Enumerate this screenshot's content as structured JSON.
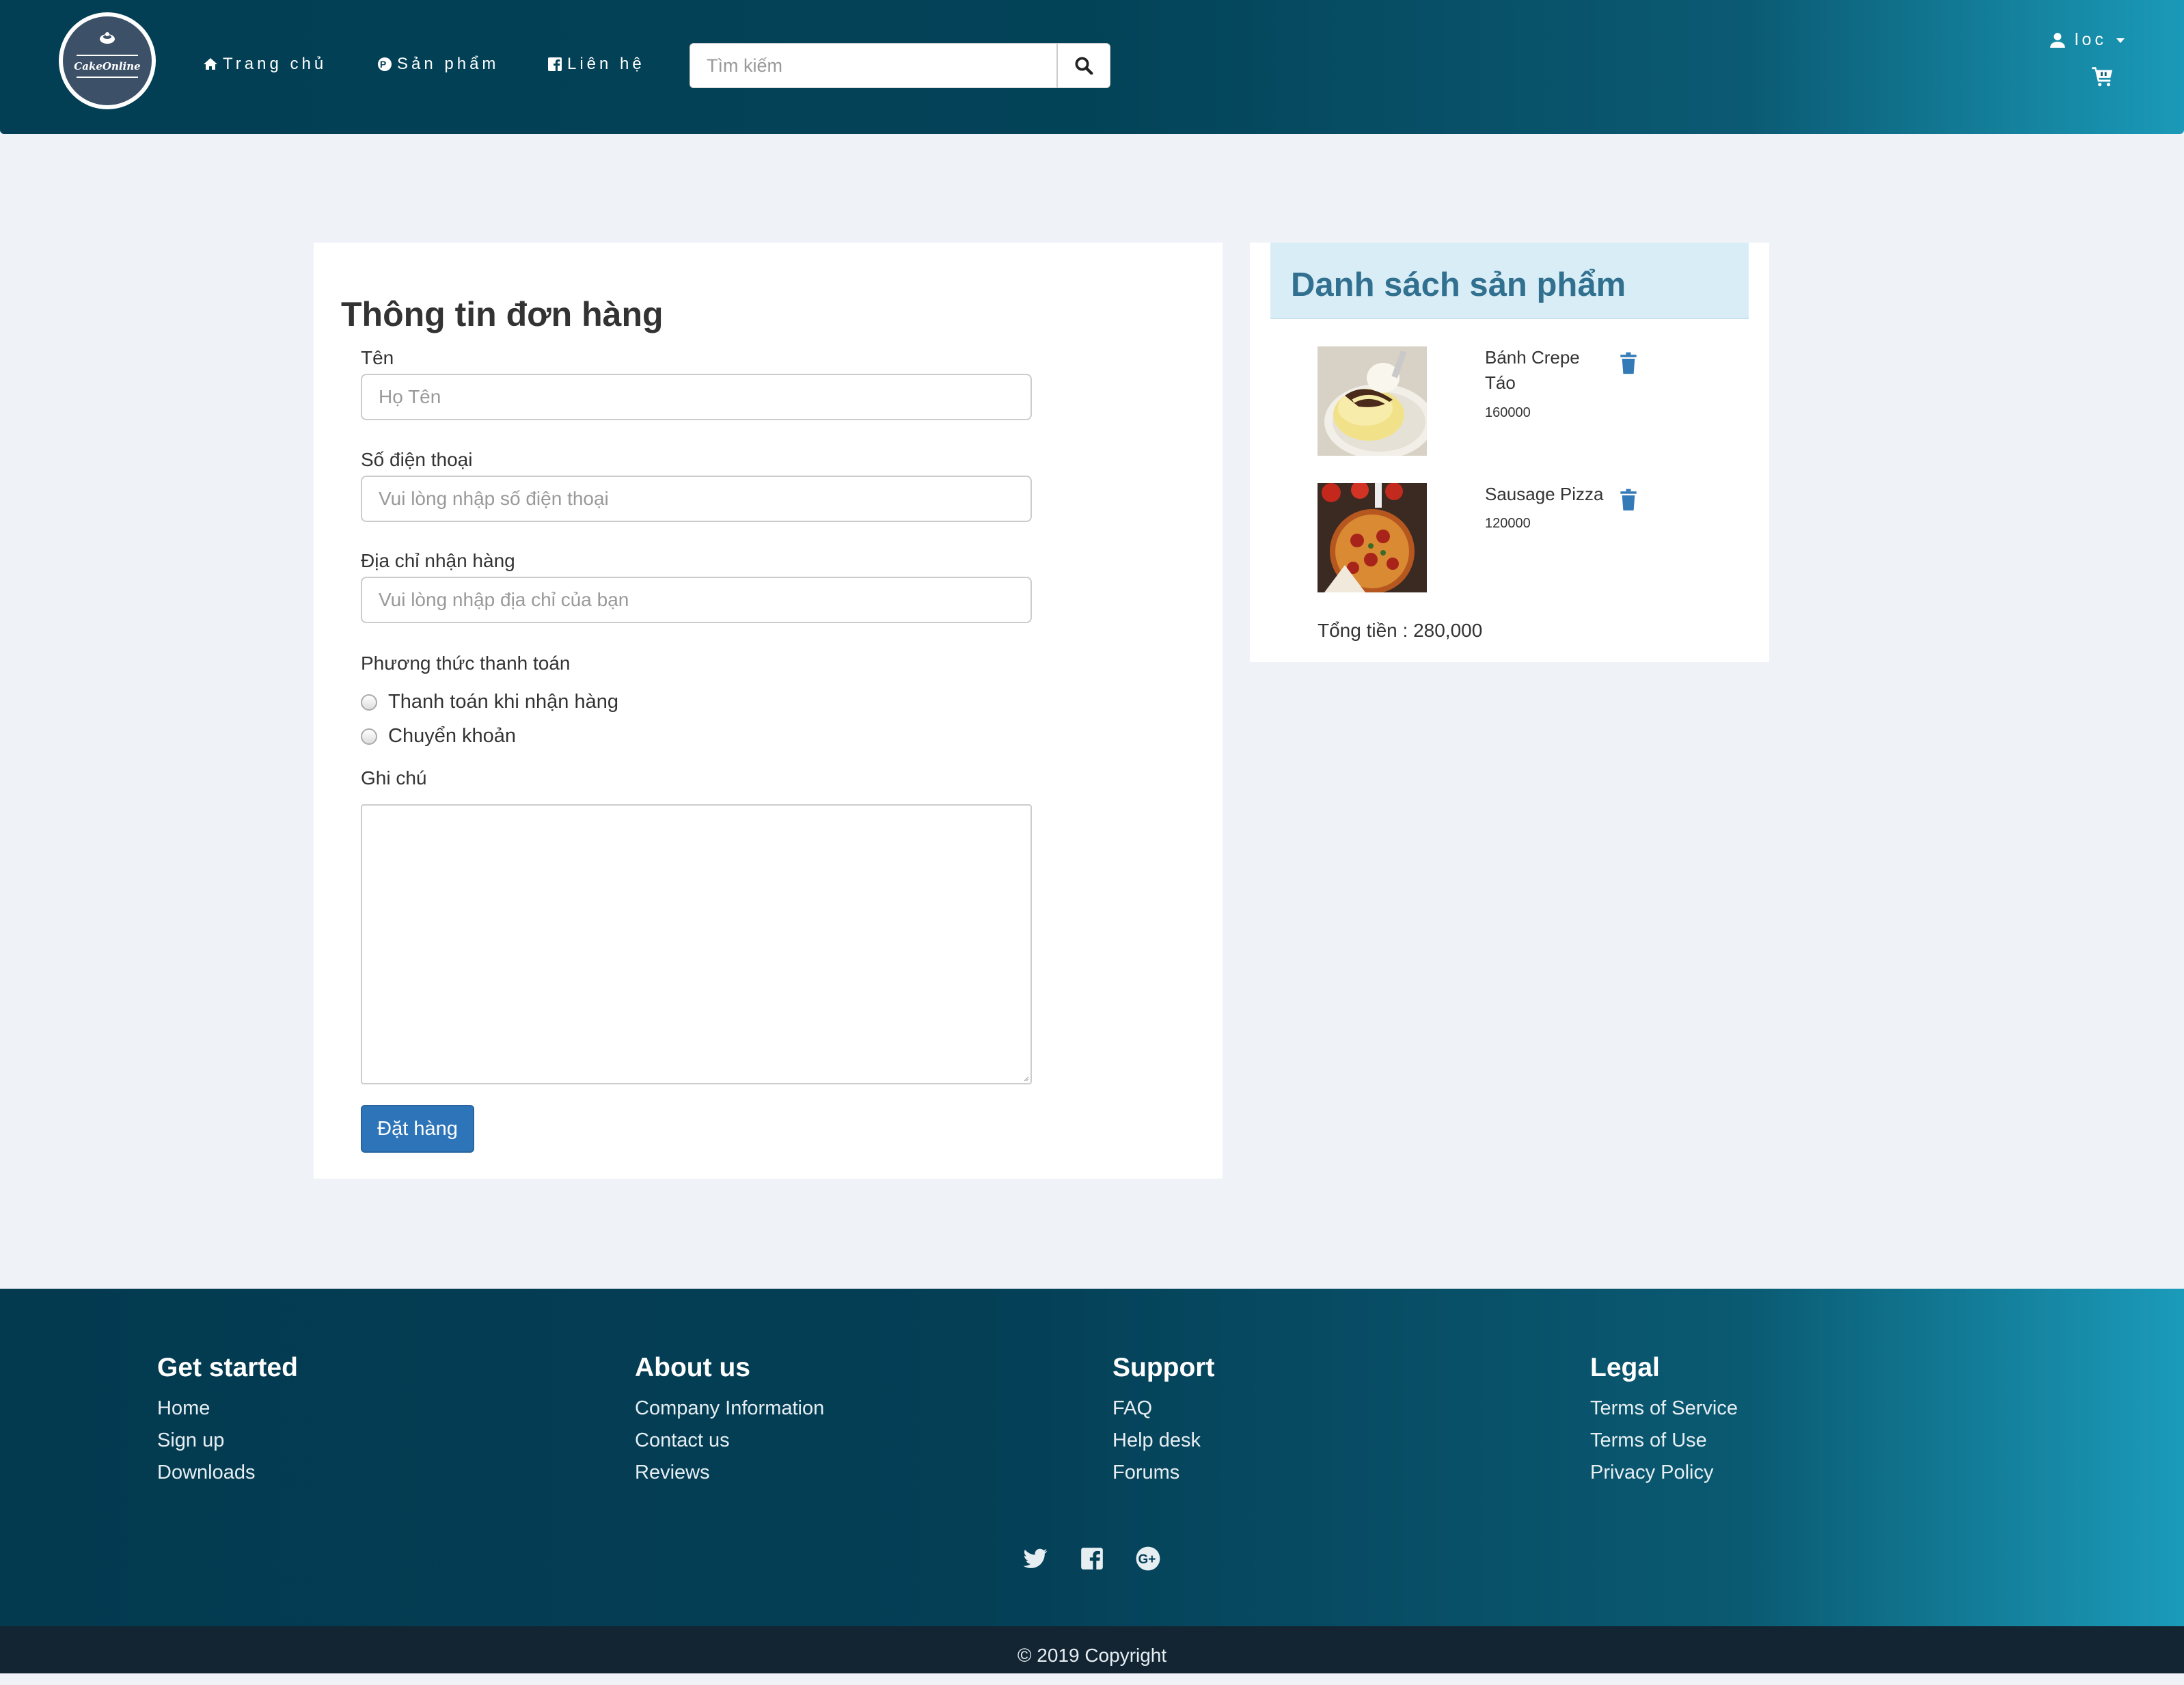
{
  "header": {
    "logo_text": "CakeOnline",
    "nav": [
      {
        "label": "Trang chủ",
        "icon": "home-icon"
      },
      {
        "label": "Sản phẩm",
        "icon": "product-icon"
      },
      {
        "label": "Liên hệ",
        "icon": "facebook-icon"
      }
    ],
    "search": {
      "placeholder": "Tìm kiếm",
      "value": ""
    },
    "user": {
      "name": "loc"
    }
  },
  "order_form": {
    "title": "Thông tin đơn hàng",
    "name": {
      "label": "Tên",
      "placeholder": "Họ Tên"
    },
    "phone": {
      "label": "Số điện thoại",
      "placeholder": "Vui lòng nhập số điện thoại"
    },
    "address": {
      "label": "Địa chỉ nhận hàng",
      "placeholder": "Vui lòng nhập địa chỉ của bạn"
    },
    "payment": {
      "label": "Phương thức thanh toán",
      "options": [
        "Thanh toán khi nhận hàng",
        "Chuyển khoản"
      ]
    },
    "note": {
      "label": "Ghi chú",
      "value": ""
    },
    "submit_label": "Đặt hàng"
  },
  "product_list": {
    "title": "Danh sách sản phẩm",
    "items": [
      {
        "name": "Bánh Crepe Táo",
        "price": "160000"
      },
      {
        "name": "Sausage Pizza",
        "price": "120000"
      }
    ],
    "total": "Tổng tiền : 280,000"
  },
  "footer": {
    "columns": [
      {
        "title": "Get started",
        "links": [
          "Home",
          "Sign up",
          "Downloads"
        ]
      },
      {
        "title": "About us",
        "links": [
          "Company Information",
          "Contact us",
          "Reviews"
        ]
      },
      {
        "title": "Support",
        "links": [
          "FAQ",
          "Help desk",
          "Forums"
        ]
      },
      {
        "title": "Legal",
        "links": [
          "Terms of Service",
          "Terms of Use",
          "Privacy Policy"
        ]
      }
    ],
    "social": [
      "twitter-icon",
      "facebook-icon",
      "google-plus-icon"
    ],
    "copyright": "© 2019 Copyright"
  },
  "colors": {
    "header_dark": "#023e54",
    "header_light": "#1a9ab8",
    "primary_button": "#2e74b8",
    "panel_heading_bg": "#d9edf7",
    "panel_heading_text": "#31708f",
    "page_bg": "#eff3f8"
  }
}
